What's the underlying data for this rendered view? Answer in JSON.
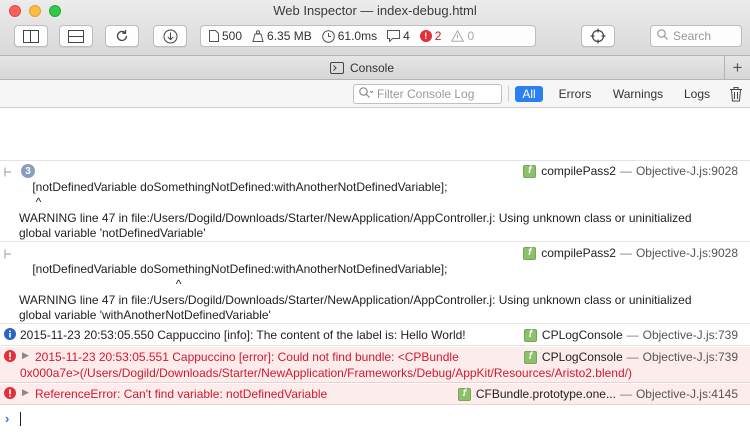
{
  "window": {
    "title": "Web Inspector — index-debug.html"
  },
  "toolbar": {
    "stats": {
      "resources": "500",
      "size": "6.35 MB",
      "time": "61.0ms",
      "logs": "4",
      "errors": "2",
      "warnings": "0"
    },
    "search_placeholder": "Search"
  },
  "tabs": {
    "console_label": "Console",
    "add_label": "+"
  },
  "filter": {
    "placeholder": "Filter Console Log",
    "all": "All",
    "errors": "Errors",
    "warnings": "Warnings",
    "logs": "Logs"
  },
  "messages": [
    {
      "count": "3",
      "code": "    [notDefinedVariable doSomethingNotDefined:withAnotherNotDefinedVariable];",
      "caret": "     ^",
      "text1": "WARNING line 47 in file:/Users/Dogild/Downloads/Starter/NewApplication/AppController.j: Using unknown class or uninitialized",
      "text2": "global variable 'notDefinedVariable'",
      "function": "compilePass2",
      "location": "Objective-J.js:9028"
    },
    {
      "code": "    [notDefinedVariable doSomethingNotDefined:withAnotherNotDefinedVariable];",
      "caret": "                                               ^",
      "text1": "WARNING line 47 in file:/Users/Dogild/Downloads/Starter/NewApplication/AppController.j: Using unknown class or uninitialized",
      "text2": "global variable 'withAnotherNotDefinedVariable'",
      "function": "compilePass2",
      "location": "Objective-J.js:9028"
    },
    {
      "text": "2015-11-23 20:53:05.550 Cappuccino [info]: The content of the label is: Hello World!",
      "function": "CPLogConsole",
      "location": "Objective-J.js:739"
    },
    {
      "text1": "2015-11-23 20:53:05.551 Cappuccino [error]: Could not find bundle: <CPBundle",
      "text2": "0x000a7e>(/Users/Dogild/Downloads/Starter/NewApplication/Frameworks/Debug/AppKit/Resources/Aristo2.blend/)",
      "function": "CPLogConsole",
      "location": "Objective-J.js:739"
    },
    {
      "text": "ReferenceError: Can't find variable: notDefinedVariable",
      "function": "CFBundle.prototype.one...",
      "location": "Objective-J.js:4145"
    }
  ],
  "colors": {
    "accent": "#2c7ff0",
    "error": "#d2192c",
    "error_bg": "#fcecec",
    "info": "#2c62c8"
  }
}
